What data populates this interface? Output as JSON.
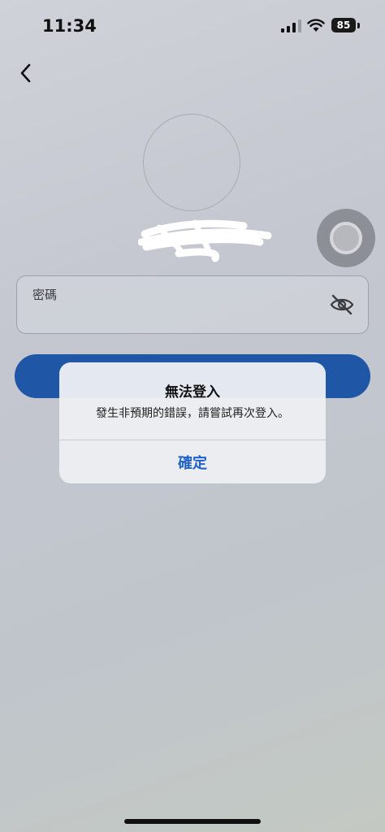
{
  "status_bar": {
    "time": "11:34",
    "battery_level": "85",
    "icons": [
      "signal-icon",
      "wifi-icon",
      "battery-icon"
    ]
  },
  "nav": {
    "back_icon": "chevron-left-icon"
  },
  "login_form": {
    "password_label": "密碼",
    "password_visibility_icon": "eye-slash-icon",
    "login_button_color": "#1f56a6"
  },
  "alert": {
    "title": "無法登入",
    "message": "發生非預期的錯誤，請嘗試再次登入。",
    "confirm_label": "確定",
    "confirm_color": "#1f62c8"
  }
}
